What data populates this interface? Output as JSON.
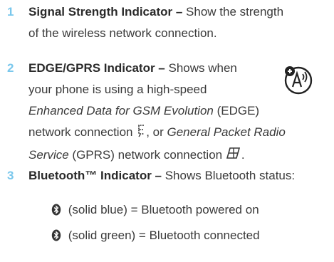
{
  "items": [
    {
      "number": "1",
      "title": "Signal Strength Indicator –",
      "text_line1": " Show the strength",
      "text_line2": "of the wireless network connection."
    },
    {
      "number": "2",
      "title": "EDGE/GPRS Indicator –",
      "text_a": " Shows when",
      "text_b": "your phone is using a high-speed",
      "edge_term": "Enhanced Data for GSM Evolution",
      "edge_abbr": " (EDGE)",
      "text_c": "network connection ",
      "text_d": ", or ",
      "gprs_term1": "General Packet Radio",
      "gprs_term2": "Service",
      "gprs_abbr": " (GPRS) network connection ",
      "end_period": "."
    },
    {
      "number": "3",
      "title": "Bluetooth™ Indicator –",
      "text": " Shows Bluetooth status:",
      "states": [
        {
          "text": " (solid blue) = Bluetooth powered on"
        },
        {
          "text": " (solid green) = Bluetooth connected"
        }
      ]
    }
  ],
  "icons": {
    "side": "feature-availability-icon",
    "edge": "edge-network-icon",
    "gprs": "gprs-network-icon",
    "bluetooth": "bluetooth-icon"
  },
  "colors": {
    "number_accent": "#79c7ec",
    "text": "#3a3a3a"
  }
}
